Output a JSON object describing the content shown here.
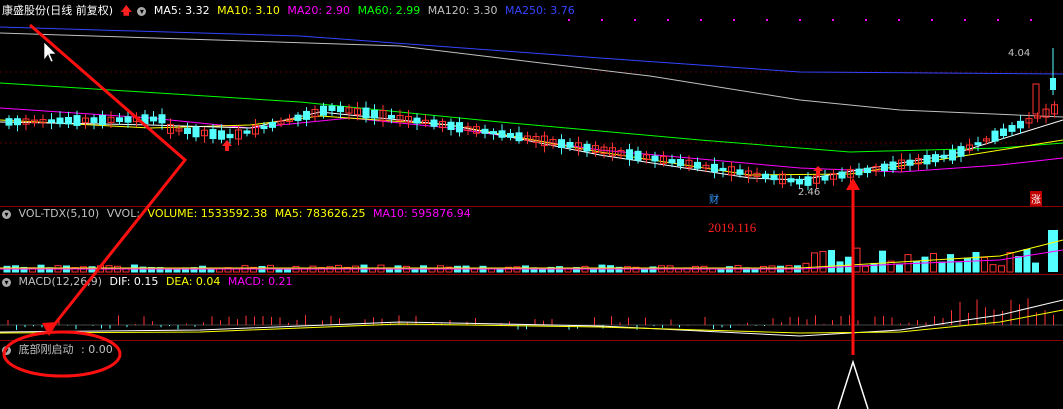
{
  "main": {
    "stock": "康盛股份(日线 前复权)",
    "ma": [
      {
        "label": "MA5: 3.32",
        "color": "#ffffff"
      },
      {
        "label": "MA10: 3.10",
        "color": "#ffff00"
      },
      {
        "label": "MA20: 2.90",
        "color": "#ff00ff"
      },
      {
        "label": "MA60: 2.99",
        "color": "#00ff00"
      },
      {
        "label": "MA120: 3.30",
        "color": "#c0c0c0"
      },
      {
        "label": "MA250: 3.76",
        "color": "#3344ff"
      }
    ],
    "high_label": "4.04",
    "low_label": "2.46",
    "marker_cai": "财",
    "marker_zhang": "涨",
    "annotation": "2019.116"
  },
  "vol": {
    "title": "VOL-TDX(5,10)",
    "vvol": "VVOL:",
    "volume": "VOLUME: 1533592.38",
    "ma5": "MA5: 783626.25",
    "ma10": "MA10: 595876.94"
  },
  "macd": {
    "title": "MACD(12,26,9)",
    "dif": "DIF: 0.15",
    "dea": "DEA: 0.04",
    "macd": "MACD: 0.21"
  },
  "signal": {
    "title": "底部刚启动",
    "value": ": 0.00"
  },
  "colors": {
    "up": "#ff3232",
    "down": "#54ffff",
    "ma5": "#ffffff",
    "ma10": "#ffff00",
    "ma20": "#ff00ff",
    "ma60": "#00ff00",
    "ma120": "#c0c0c0",
    "ma250": "#3344ff"
  }
}
